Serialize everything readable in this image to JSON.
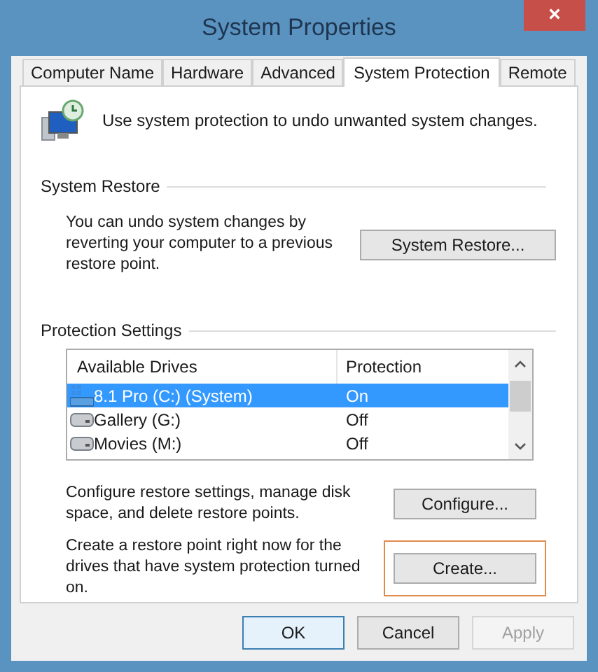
{
  "window": {
    "title": "System Properties",
    "close": "×"
  },
  "tabs": [
    {
      "label": "Computer Name",
      "selected": false
    },
    {
      "label": "Hardware",
      "selected": false
    },
    {
      "label": "Advanced",
      "selected": false
    },
    {
      "label": "System Protection",
      "selected": true
    },
    {
      "label": "Remote",
      "selected": false
    }
  ],
  "intro": "Use system protection to undo unwanted system changes.",
  "system_restore": {
    "heading": "System Restore",
    "text": "You can undo system changes by reverting your computer to a previous restore point.",
    "button": "System Restore..."
  },
  "protection_settings": {
    "heading": "Protection Settings",
    "columns": [
      "Available Drives",
      "Protection"
    ],
    "drives": [
      {
        "kind": "system",
        "name": "8.1 Pro (C:) (System)",
        "protection": "On",
        "selected": true
      },
      {
        "kind": "drive",
        "name": "Gallery (G:)",
        "protection": "Off",
        "selected": false
      },
      {
        "kind": "drive",
        "name": "Movies (M:)",
        "protection": "Off",
        "selected": false
      }
    ],
    "configure_text": "Configure restore settings, manage disk space, and delete restore points.",
    "configure_button": "Configure...",
    "create_text": "Create a restore point right now for the drives that have system protection turned on.",
    "create_button": "Create...",
    "create_highlighted": true
  },
  "buttons": [
    {
      "label": "OK",
      "default": true,
      "disabled": false
    },
    {
      "label": "Cancel",
      "default": false,
      "disabled": false
    },
    {
      "label": "Apply",
      "default": false,
      "disabled": true
    }
  ]
}
